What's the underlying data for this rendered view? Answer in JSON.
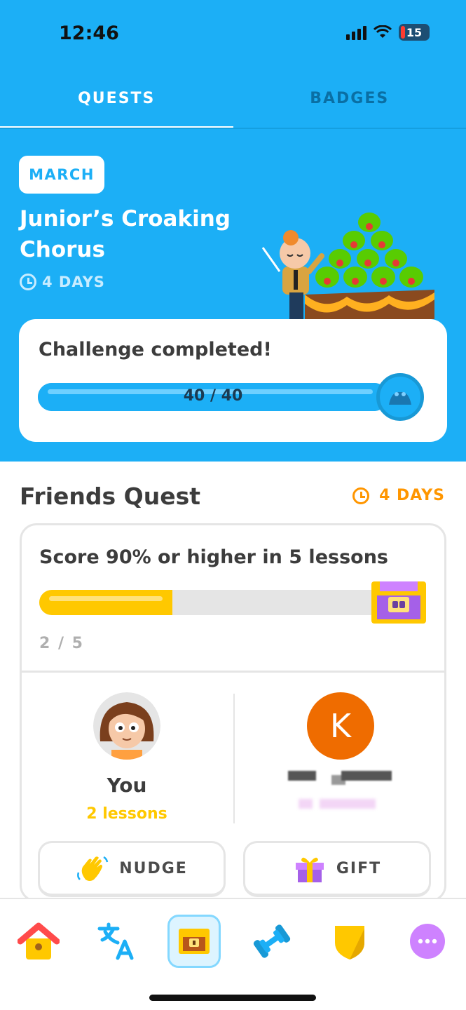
{
  "status_bar": {
    "time": "12:46",
    "battery": "15"
  },
  "tabs": [
    {
      "label": "QUESTS",
      "active": true
    },
    {
      "label": "BADGES",
      "active": false
    }
  ],
  "monthly_challenge": {
    "month": "MARCH",
    "title": "Junior’s Croaking Chorus",
    "time_left": "4 DAYS",
    "status": "Challenge completed!",
    "progress_label": "40 / 40",
    "progress_fraction": 1.0
  },
  "friends_quest": {
    "title": "Friends Quest",
    "time_left": "4 DAYS",
    "task": "Score 90% or higher in 5 lessons",
    "progress_label": "2 / 5",
    "progress_fraction": 0.4,
    "you": {
      "name": "You",
      "lessons": "2 lessons"
    },
    "friend": {
      "initial": "K"
    },
    "nudge_label": "NUDGE",
    "gift_label": "GIFT"
  },
  "bottom_nav": [
    "home-icon",
    "translate-icon",
    "quests-chest-icon",
    "dumbbell-icon",
    "league-shield-icon",
    "more-icon"
  ],
  "colors": {
    "brand_blue": "#1caff6",
    "gold": "#ffc800",
    "orange": "#ff9600"
  }
}
